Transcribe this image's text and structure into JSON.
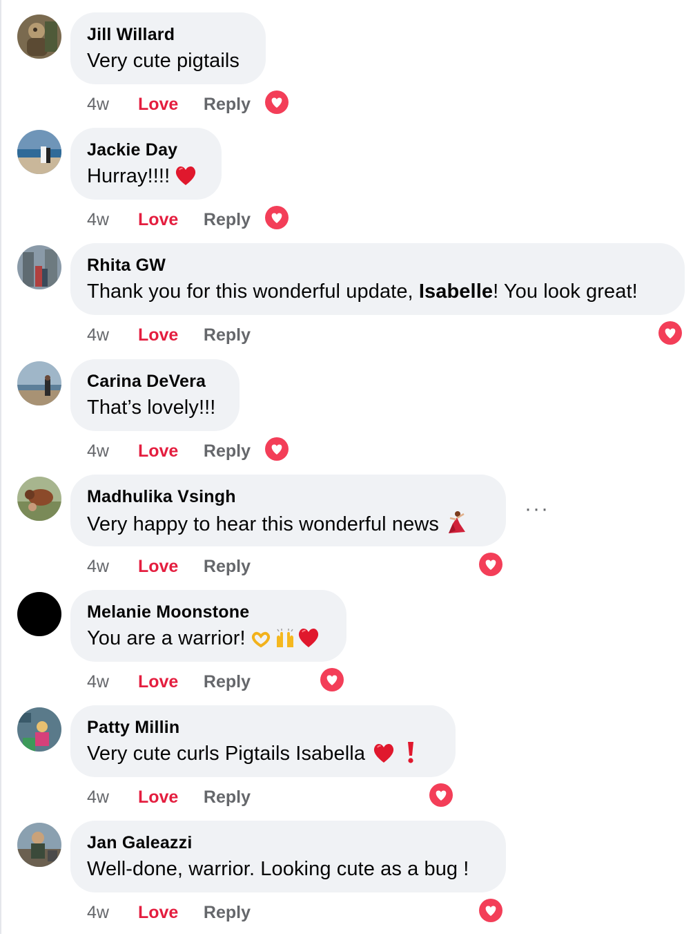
{
  "comments": [
    {
      "author": "Jill Willard",
      "text": "Very cute pigtails",
      "time": "4w",
      "love": "Love",
      "reply": "Reply"
    },
    {
      "author": "Jackie Day",
      "text": "Hurray!!!!",
      "time": "4w",
      "love": "Love",
      "reply": "Reply"
    },
    {
      "author": "Rhita GW",
      "text_before": "Thank you for this wonderful update, ",
      "mention": "Isabelle",
      "text_after": "! You look great!",
      "time": "4w",
      "love": "Love",
      "reply": "Reply"
    },
    {
      "author": "Carina DeVera",
      "text": "That’s lovely!!!",
      "time": "4w",
      "love": "Love",
      "reply": "Reply"
    },
    {
      "author": "Madhulika Vsingh",
      "text": "Very happy to hear this wonderful news",
      "time": "4w",
      "love": "Love",
      "reply": "Reply",
      "more": "···"
    },
    {
      "author": "Melanie Moonstone",
      "text": "You are a warrior!",
      "time": "4w",
      "love": "Love",
      "reply": "Reply"
    },
    {
      "author": "Patty Millin",
      "text": "Very cute curls Pigtails Isabella",
      "time": "4w",
      "love": "Love",
      "reply": "Reply"
    },
    {
      "author": "Jan Galeazzi",
      "text": "Well-done, warrior. Looking cute as a bug !",
      "time": "4w",
      "love": "Love",
      "reply": "Reply"
    }
  ],
  "icons": {
    "reaction": "love-reaction-icon",
    "heart_emoji": "red-heart-emoji",
    "dancer_emoji": "dancer-emoji",
    "heart_hands_emoji": "heart-hands-emoji",
    "raised_hands_emoji": "raised-hands-emoji",
    "exclamation_emoji": "exclamation-emoji",
    "more": "more-options-icon"
  },
  "colors": {
    "love": "#e41e3f",
    "bubble": "#f0f2f5",
    "meta": "#65676b",
    "reaction": "#f33e58"
  }
}
